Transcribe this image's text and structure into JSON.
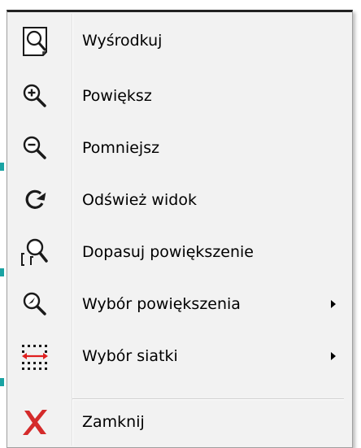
{
  "menu": {
    "items": [
      {
        "label": "Wyśrodkuj",
        "icon": "center-view-icon",
        "submenu": false
      },
      {
        "label": "Powiększ",
        "icon": "zoom-in-icon",
        "submenu": false
      },
      {
        "label": "Pomniejsz",
        "icon": "zoom-out-icon",
        "submenu": false
      },
      {
        "label": "Odśwież widok",
        "icon": "refresh-icon",
        "submenu": false
      },
      {
        "label": "Dopasuj powiększenie",
        "icon": "zoom-fit-icon",
        "submenu": false
      },
      {
        "label": "Wybór powiększenia",
        "icon": "zoom-select-icon",
        "submenu": true
      },
      {
        "label": "Wybór siatki",
        "icon": "grid-select-icon",
        "submenu": true
      }
    ],
    "close": {
      "label": "Zamknij",
      "icon": "close-icon"
    }
  },
  "colors": {
    "menu_bg": "#f2f2f2",
    "icon_dark": "#1a1a1a",
    "grid_arrow": "#e02020",
    "close_red": "#d42b2b"
  }
}
